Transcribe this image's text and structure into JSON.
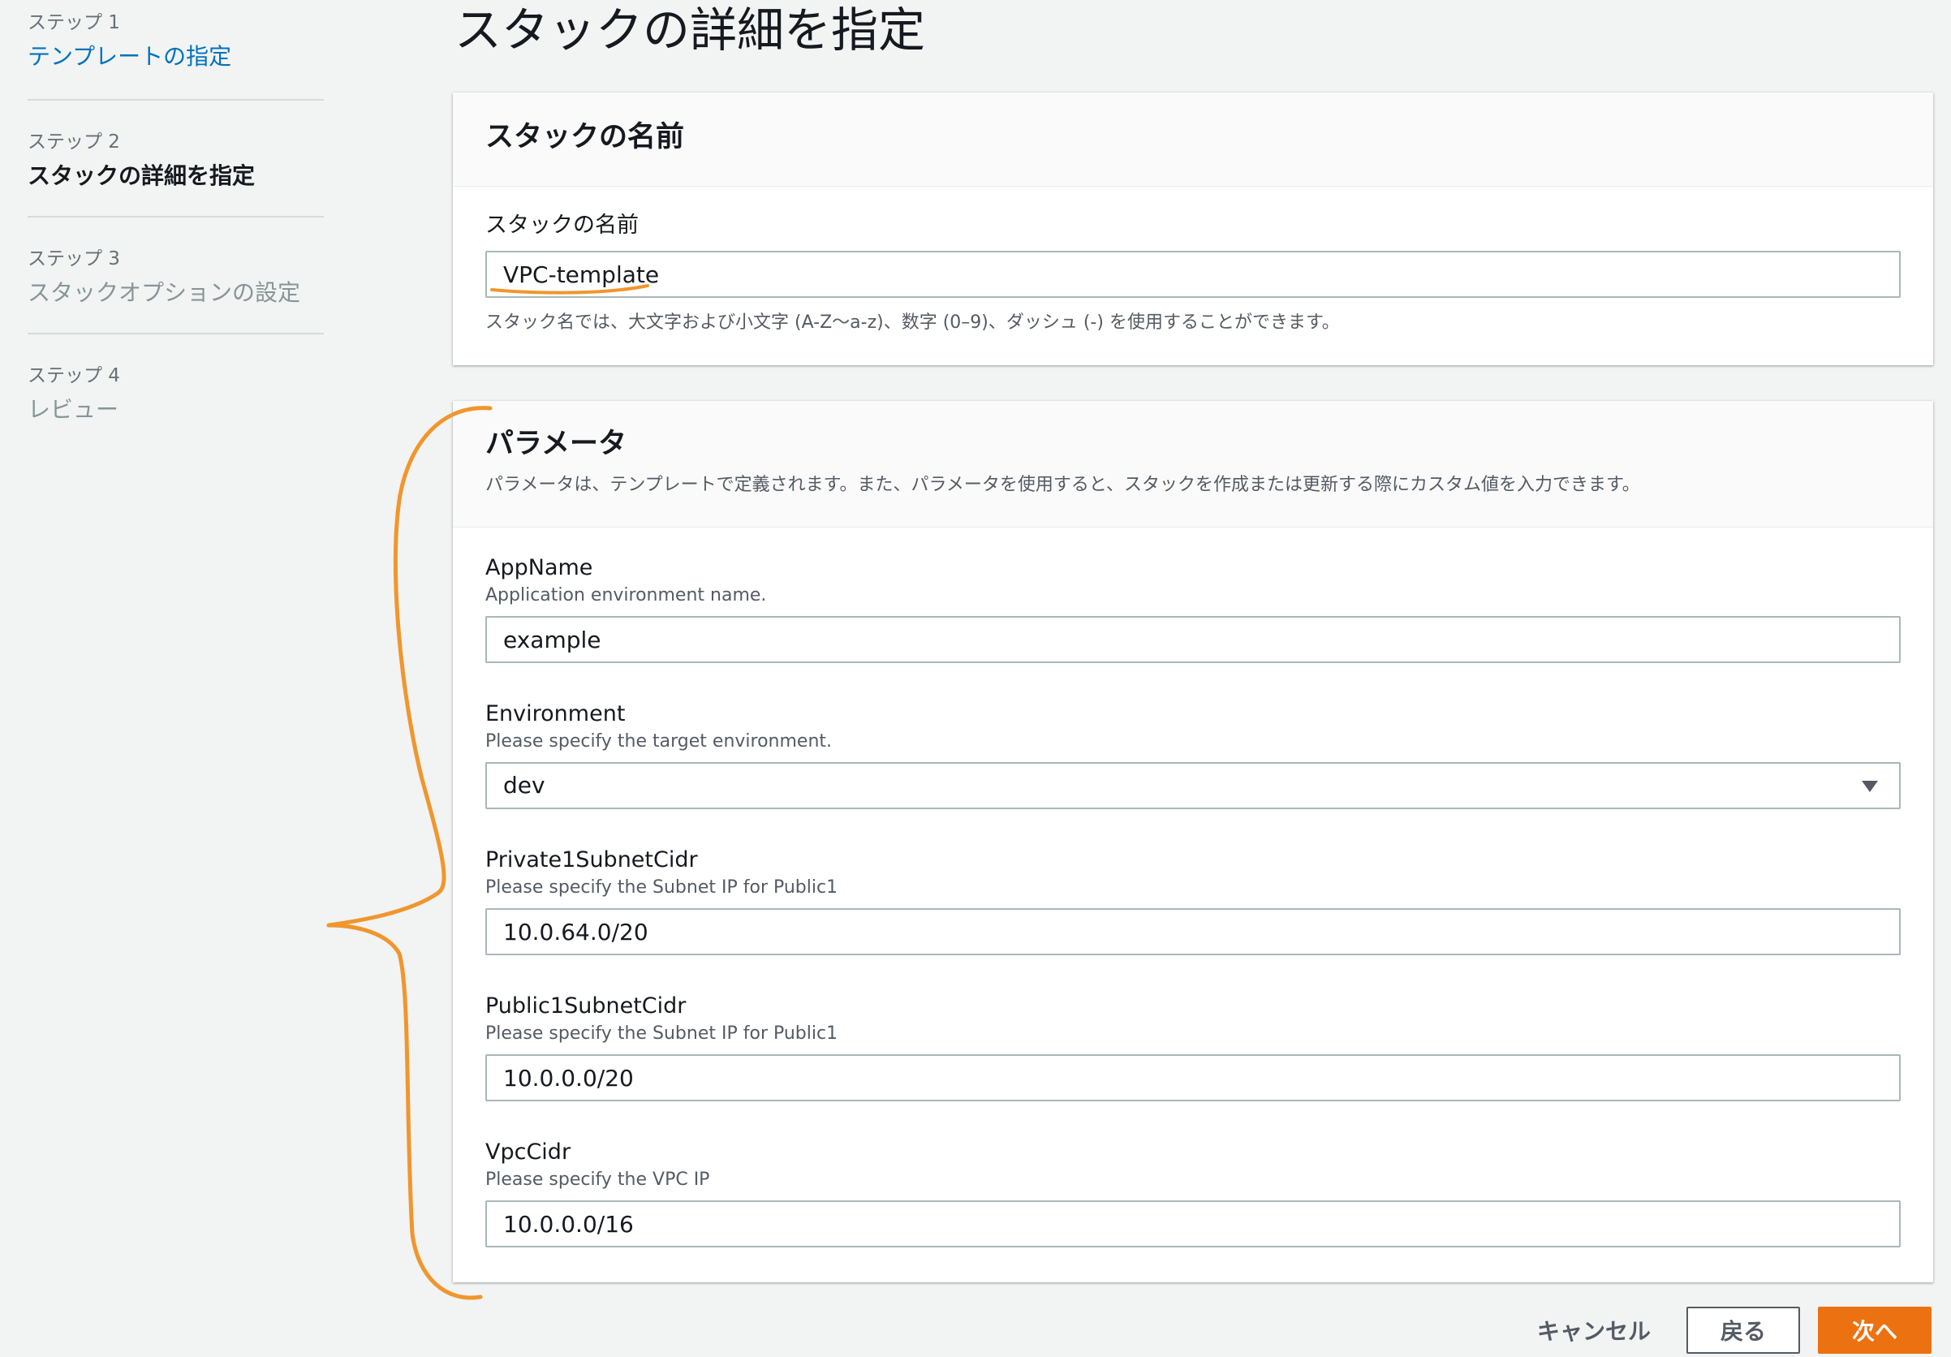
{
  "nav": {
    "steps": [
      {
        "number": "ステップ 1",
        "title": "テンプレートの指定"
      },
      {
        "number": "ステップ 2",
        "title": "スタックの詳細を指定"
      },
      {
        "number": "ステップ 3",
        "title": "スタックオプションの設定"
      },
      {
        "number": "ステップ 4",
        "title": "レビュー"
      }
    ]
  },
  "page_title": "スタックの詳細を指定",
  "stack_name_panel": {
    "title": "スタックの名前",
    "label": "スタックの名前",
    "value": "VPC-template",
    "constraint": "スタック名では、大文字および小文字 (A-Z〜a-z)、数字 (0–9)、ダッシュ (-) を使用することができます。"
  },
  "parameters_panel": {
    "title": "パラメータ",
    "description": "パラメータは、テンプレートで定義されます。また、パラメータを使用すると、スタックを作成または更新する際にカスタム値を入力できます。",
    "params": [
      {
        "name": "AppName",
        "description": "Application environment name.",
        "value": "example"
      },
      {
        "name": "Environment",
        "description": "Please specify the target environment.",
        "value": "dev"
      },
      {
        "name": "Private1SubnetCidr",
        "description": "Please specify the Subnet IP for Public1",
        "value": "10.0.64.0/20"
      },
      {
        "name": "Public1SubnetCidr",
        "description": "Please specify the Subnet IP for Public1",
        "value": "10.0.0.0/20"
      },
      {
        "name": "VpcCidr",
        "description": "Please specify the VPC IP",
        "value": "10.0.0.0/16"
      }
    ]
  },
  "footer": {
    "cancel_label": "キャンセル",
    "back_label": "戻る",
    "next_label": "次へ"
  },
  "colors": {
    "link": "#0073bb",
    "primary": "#ec7211",
    "annotation": "#f0962d",
    "background": "#f2f3f3"
  }
}
